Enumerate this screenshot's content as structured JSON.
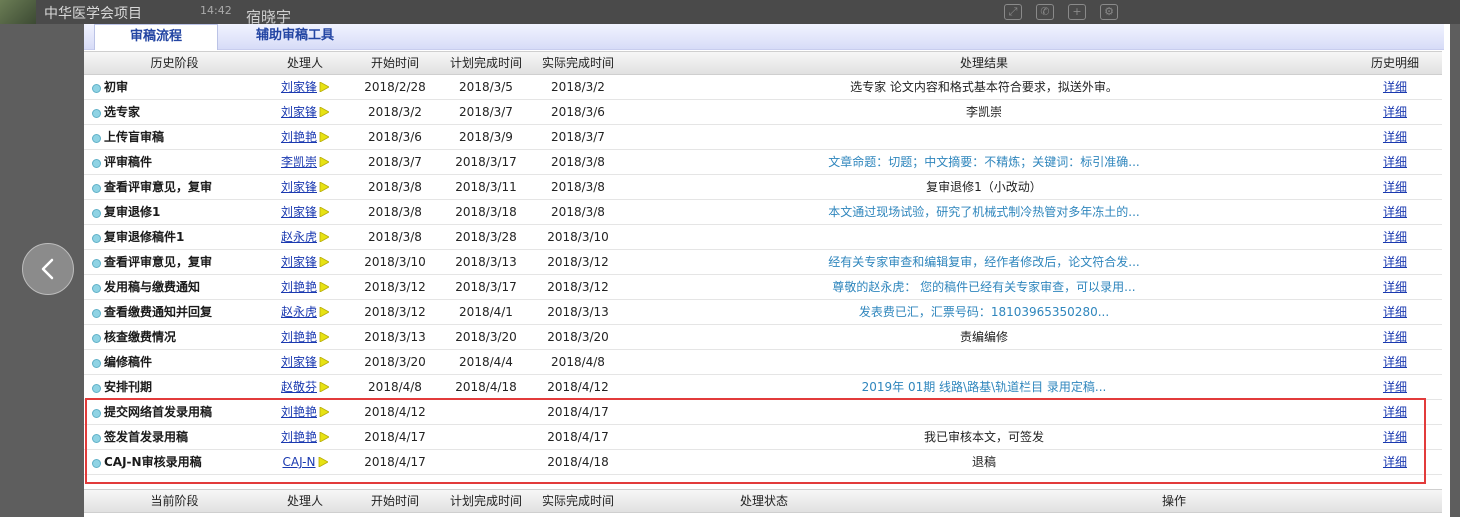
{
  "topbar": {
    "app_title": "中华医学会项目",
    "time": "14:42",
    "person": "宿晓宇",
    "icons": [
      "screen-icon",
      "phone-icon",
      "add-icon",
      "settings-icon"
    ]
  },
  "tabs": [
    {
      "label": "审稿流程",
      "active": true
    },
    {
      "label": "辅助审稿工具",
      "active": false
    }
  ],
  "history_headers": {
    "stage": "历史阶段",
    "handler": "处理人",
    "start": "开始时间",
    "planned": "计划完成时间",
    "actual": "实际完成时间",
    "result": "处理结果",
    "detail": "历史明细"
  },
  "rows": [
    {
      "stage": "初审",
      "handler": "刘家锋",
      "start": "2018/2/28",
      "planned": "2018/3/5",
      "actual": "2018/3/2",
      "result": "选专家 论文内容和格式基本符合要求，拟送外审。",
      "result_link": false,
      "detail": "详细"
    },
    {
      "stage": "选专家",
      "handler": "刘家锋",
      "start": "2018/3/2",
      "planned": "2018/3/7",
      "actual": "2018/3/6",
      "result": "李凯崇",
      "result_link": false,
      "detail": "详细"
    },
    {
      "stage": "上传盲审稿",
      "handler": "刘艳艳",
      "start": "2018/3/6",
      "planned": "2018/3/9",
      "actual": "2018/3/7",
      "result": "",
      "result_link": false,
      "detail": "详细"
    },
    {
      "stage": "评审稿件",
      "handler": "李凯崇",
      "start": "2018/3/7",
      "planned": "2018/3/17",
      "actual": "2018/3/8",
      "result": "文章命题：切题；中文摘要：不精炼；关键词：标引准确...",
      "result_link": true,
      "detail": "详细"
    },
    {
      "stage": "查看评审意见，复审",
      "handler": "刘家锋",
      "start": "2018/3/8",
      "planned": "2018/3/11",
      "actual": "2018/3/8",
      "result": "复审退修1（小改动）",
      "result_link": false,
      "detail": "详细"
    },
    {
      "stage": "复审退修1",
      "handler": "刘家锋",
      "start": "2018/3/8",
      "planned": "2018/3/18",
      "actual": "2018/3/8",
      "result": "本文通过现场试验，研究了机械式制冷热管对多年冻土的...",
      "result_link": true,
      "detail": "详细"
    },
    {
      "stage": "复审退修稿件1",
      "handler": "赵永虎",
      "start": "2018/3/8",
      "planned": "2018/3/28",
      "actual": "2018/3/10",
      "result": "",
      "result_link": false,
      "detail": "详细"
    },
    {
      "stage": "查看评审意见，复审",
      "handler": "刘家锋",
      "start": "2018/3/10",
      "planned": "2018/3/13",
      "actual": "2018/3/12",
      "result": "经有关专家审查和编辑复审，经作者修改后，论文符合发...",
      "result_link": true,
      "detail": "详细"
    },
    {
      "stage": "发用稿与缴费通知",
      "handler": "刘艳艳",
      "start": "2018/3/12",
      "planned": "2018/3/17",
      "actual": "2018/3/12",
      "result": "尊敬的赵永虎： 您的稿件已经有关专家审查，可以录用...",
      "result_link": true,
      "detail": "详细"
    },
    {
      "stage": "查看缴费通知并回复",
      "handler": "赵永虎",
      "start": "2018/3/12",
      "planned": "2018/4/1",
      "actual": "2018/3/13",
      "result": "发表费已汇，汇票号码：18103965350280...",
      "result_link": true,
      "detail": "详细"
    },
    {
      "stage": "核查缴费情况",
      "handler": "刘艳艳",
      "start": "2018/3/13",
      "planned": "2018/3/20",
      "actual": "2018/3/20",
      "result": "责编编修",
      "result_link": false,
      "detail": "详细"
    },
    {
      "stage": "编修稿件",
      "handler": "刘家锋",
      "start": "2018/3/20",
      "planned": "2018/4/4",
      "actual": "2018/4/8",
      "result": "",
      "result_link": false,
      "detail": "详细"
    },
    {
      "stage": "安排刊期",
      "handler": "赵敬芬",
      "start": "2018/4/8",
      "planned": "2018/4/18",
      "actual": "2018/4/12",
      "result": "2019年 01期 线路\\路基\\轨道栏目 录用定稿...",
      "result_link": true,
      "detail": "详细"
    },
    {
      "stage": "提交网络首发录用稿",
      "handler": "刘艳艳",
      "start": "2018/4/12",
      "planned": "",
      "actual": "2018/4/17",
      "result": "",
      "result_link": false,
      "detail": "详细"
    },
    {
      "stage": "签发首发录用稿",
      "handler": "刘艳艳",
      "start": "2018/4/17",
      "planned": "",
      "actual": "2018/4/17",
      "result": "我已审核本文，可签发",
      "result_link": false,
      "detail": "详细"
    },
    {
      "stage": "CAJ-N审核录用稿",
      "handler": "CAJ-N",
      "start": "2018/4/17",
      "planned": "",
      "actual": "2018/4/18",
      "result": "退稿",
      "result_link": false,
      "detail": "详细"
    }
  ],
  "current_headers": {
    "stage": "当前阶段",
    "handler": "处理人",
    "start": "开始时间",
    "planned": "计划完成时间",
    "actual": "实际完成时间",
    "status": "处理状态",
    "action": "操作"
  },
  "colors": {
    "link": "#1a39b0",
    "result_link": "#2f86bd",
    "highlight": "#e23b3b",
    "tab_text": "#2345a3"
  }
}
